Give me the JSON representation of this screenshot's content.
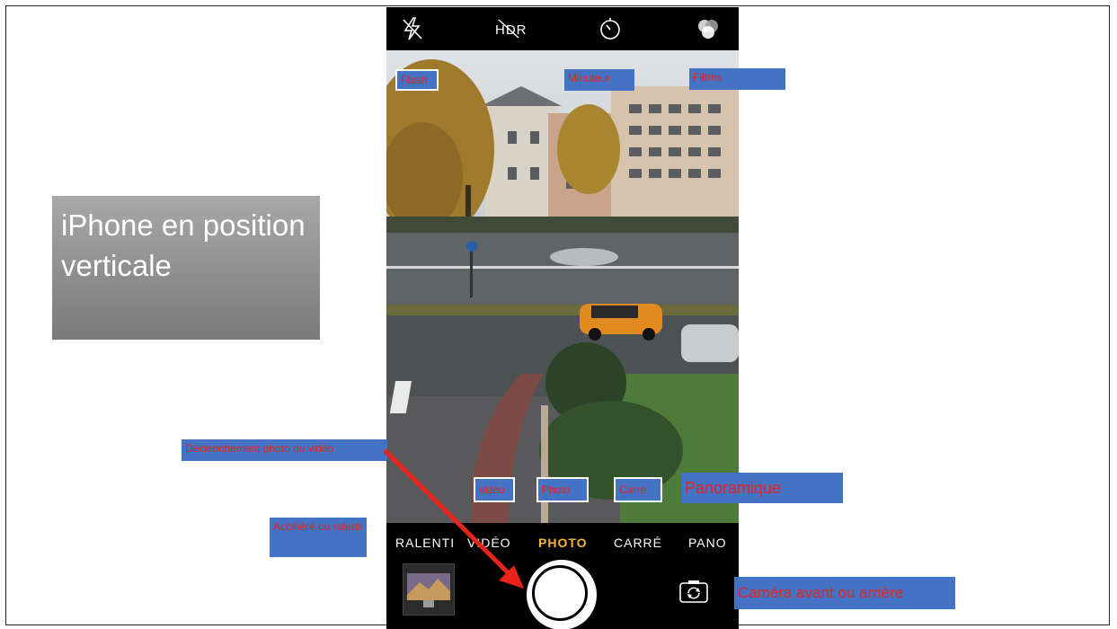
{
  "slide_title": "iPhone en position verticale",
  "camera": {
    "top_icons": [
      "flash-off-icon",
      "hdr-off-icon",
      "timer-icon",
      "filters-icon"
    ],
    "hdr_text": "HDR",
    "modes": [
      "RALENTI",
      "VIDÉO",
      "PHOTO",
      "CARRÉ",
      "PANO"
    ],
    "active_mode": "PHOTO",
    "active_mode_color": "#f2b733"
  },
  "annotations": {
    "flash": "Flash",
    "minuteur": "Minuteur",
    "filtres": "Filtres",
    "declenchement": "Déclenchement photo ou vidéo",
    "video": "vidéo",
    "photo": "Photo",
    "carre": "Carré",
    "panoramique": "Panoramique",
    "accelere": "Accéléré ou ralenti",
    "camera_switch": "Caméra avant ou arrière"
  },
  "colors": {
    "label_bg": "#4472c4",
    "label_text": "#e8231c",
    "arrow": "#e8231c"
  }
}
